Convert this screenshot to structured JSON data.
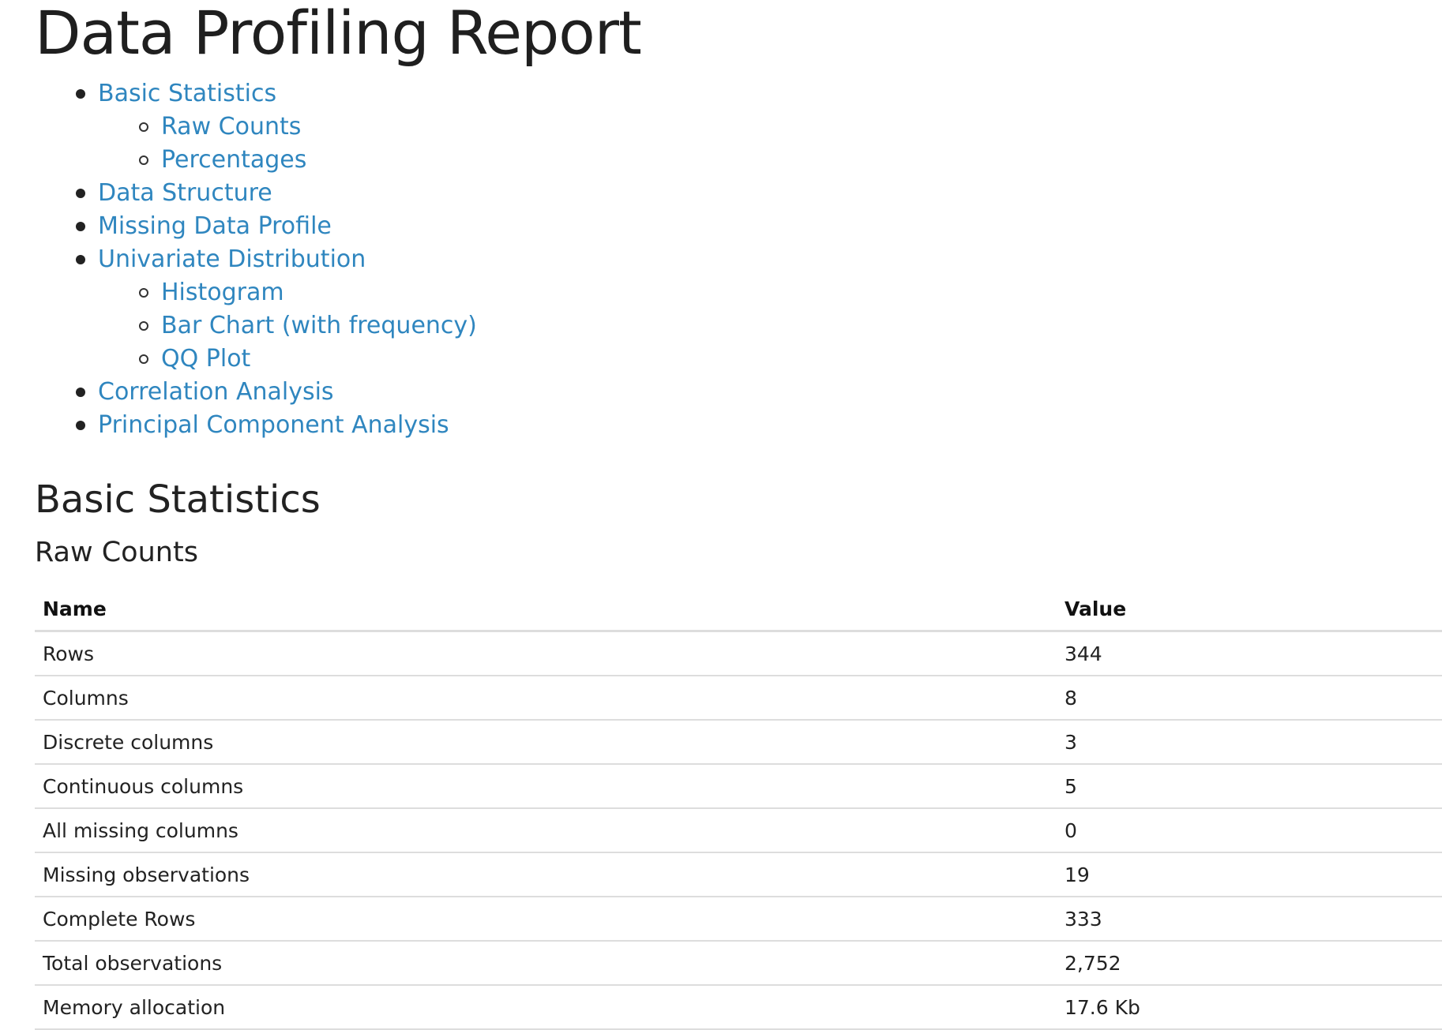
{
  "title": "Data Profiling Report",
  "toc": [
    {
      "label": "Basic Statistics",
      "level": 1
    },
    {
      "label": "Raw Counts",
      "level": 2
    },
    {
      "label": "Percentages",
      "level": 2
    },
    {
      "label": "Data Structure",
      "level": 1
    },
    {
      "label": "Missing Data Profile",
      "level": 1
    },
    {
      "label": "Univariate Distribution",
      "level": 1
    },
    {
      "label": "Histogram",
      "level": 2
    },
    {
      "label": "Bar Chart (with frequency)",
      "level": 2
    },
    {
      "label": "QQ Plot",
      "level": 2
    },
    {
      "label": "Correlation Analysis",
      "level": 1
    },
    {
      "label": "Principal Component Analysis",
      "level": 1
    }
  ],
  "section": {
    "title": "Basic Statistics",
    "subtitle": "Raw Counts"
  },
  "table": {
    "headers": [
      "Name",
      "Value"
    ],
    "rows": [
      [
        "Rows",
        "344"
      ],
      [
        "Columns",
        "8"
      ],
      [
        "Discrete columns",
        "3"
      ],
      [
        "Continuous columns",
        "5"
      ],
      [
        "All missing columns",
        "0"
      ],
      [
        "Missing observations",
        "19"
      ],
      [
        "Complete Rows",
        "333"
      ],
      [
        "Total observations",
        "2,752"
      ],
      [
        "Memory allocation",
        "17.6 Kb"
      ]
    ]
  },
  "colors": {
    "link": "#2f86bf",
    "text": "#222222",
    "rule": "#dddddd"
  }
}
